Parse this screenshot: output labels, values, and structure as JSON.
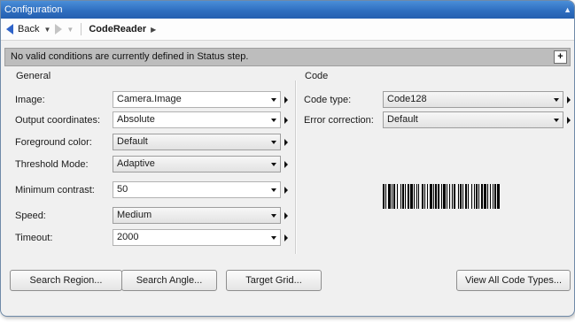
{
  "window": {
    "title": "Configuration"
  },
  "nav": {
    "back_label": "Back",
    "crumb": "CodeReader"
  },
  "status": {
    "message": "No valid conditions are currently defined in Status step.",
    "add_button": "+"
  },
  "general": {
    "title": "General",
    "rows": [
      {
        "label": "Image:",
        "value": "Camera.Image",
        "kind": "text"
      },
      {
        "label": "Output coordinates:",
        "value": "Absolute",
        "kind": "text"
      },
      {
        "label": "Foreground color:",
        "value": "Default",
        "kind": "combo"
      },
      {
        "label": "Threshold Mode:",
        "value": "Adaptive",
        "kind": "combo"
      },
      {
        "label": "Minimum contrast:",
        "value": "50",
        "kind": "text"
      },
      {
        "label": "Speed:",
        "value": "Medium",
        "kind": "combo"
      },
      {
        "label": "Timeout:",
        "value": "2000",
        "kind": "text"
      }
    ]
  },
  "code": {
    "title": "Code",
    "rows": [
      {
        "label": "Code type:",
        "value": "Code128",
        "kind": "combo"
      },
      {
        "label": "Error correction:",
        "value": "Default",
        "kind": "combo"
      }
    ]
  },
  "buttons": {
    "search_region": "Search Region...",
    "search_angle": "Search Angle...",
    "target_grid": "Target Grid...",
    "view_all_code_types": "View All Code Types..."
  },
  "colors": {
    "titlebar": "#2f6fc0",
    "status_bg": "#bdbdbd",
    "nav_back": "#2e63c9"
  }
}
